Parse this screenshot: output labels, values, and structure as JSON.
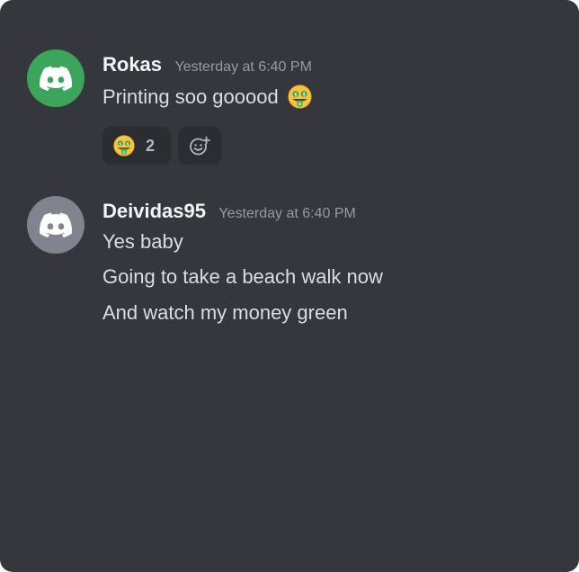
{
  "messages": [
    {
      "username": "Rokas",
      "timestamp": "Yesterday at 6:40 PM",
      "avatar_color": "#3ba55c",
      "avatar_icon": "discord-logo-icon",
      "text": "Printing soo gooood",
      "inline_emoji": "money-mouth-face-icon",
      "reactions": [
        {
          "emoji": "money-mouth-face-icon",
          "count": "2"
        }
      ]
    },
    {
      "username": "Deividas95",
      "timestamp": "Yesterday at 6:40 PM",
      "avatar_color": "#80848e",
      "avatar_icon": "discord-logo-icon",
      "lines": [
        "Yes baby",
        "Going to take a beach walk now",
        "And watch my money green"
      ]
    }
  ],
  "colors": {
    "background": "#36373d",
    "username": "#f2f3f5",
    "timestamp": "#949ba4",
    "text": "#dbdee1",
    "reaction_bg": "#2b2d31"
  }
}
